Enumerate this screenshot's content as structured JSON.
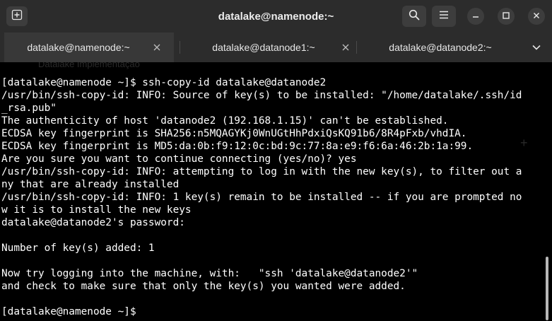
{
  "window": {
    "title": "datalake@namenode:~"
  },
  "icons": {
    "new_tab": "new-tab-icon",
    "search": "search-icon",
    "menu": "hamburger-menu-icon",
    "minimize": "minimize-icon",
    "maximize": "maximize-icon",
    "close": "close-icon",
    "tab_close": "close-icon",
    "tabs_dropdown": "chevron-down-icon"
  },
  "tabs": [
    {
      "label": "datalake@namenode:~",
      "active": true,
      "close": "×"
    },
    {
      "label": "datalake@datanode1:~",
      "active": false,
      "close": "×"
    },
    {
      "label": "datalake@datanode2:~",
      "active": false
    }
  ],
  "terminal": {
    "ghost_text": "Datalake Implementação",
    "lines": [
      "[datalake@namenode ~]$ ssh-copy-id datalake@datanode2",
      "/usr/bin/ssh-copy-id: INFO: Source of key(s) to be installed: \"/home/datalake/.ssh/id",
      "_rsa.pub\"",
      "The authenticity of host 'datanode2 (192.168.1.15)' can't be established.",
      "ECDSA key fingerprint is SHA256:n5MQAGYKj0WnUGtHhPdxiQsKQ91b6/8R4pFxb/vhdIA.",
      "ECDSA key fingerprint is MD5:da:0b:f9:12:0c:bd:9c:77:8a:e9:f6:6a:46:2b:1a:99.",
      "Are you sure you want to continue connecting (yes/no)? yes",
      "/usr/bin/ssh-copy-id: INFO: attempting to log in with the new key(s), to filter out a",
      "ny that are already installed",
      "/usr/bin/ssh-copy-id: INFO: 1 key(s) remain to be installed -- if you are prompted no",
      "w it is to install the new keys",
      "datalake@datanode2's password:",
      "",
      "Number of key(s) added: 1",
      "",
      "Now try logging into the machine, with:   \"ssh 'datalake@datanode2'\"",
      "and check to make sure that only the key(s) you wanted were added.",
      "",
      "[datalake@namenode ~]$"
    ]
  },
  "colors": {
    "titlebar_bg": "#2c2c2c",
    "button_bg": "#3d3d3d",
    "active_tab_bg": "#383838",
    "terminal_bg": "#000000",
    "terminal_fg": "#ffffff"
  }
}
